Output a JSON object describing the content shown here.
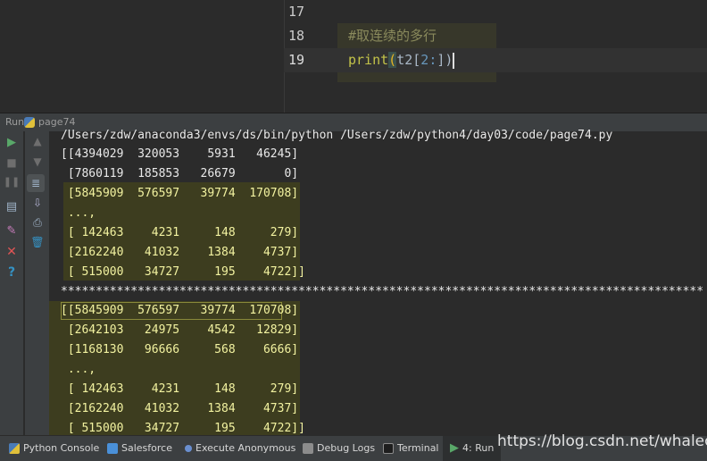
{
  "editor": {
    "lines": [
      {
        "num": "17",
        "code": ""
      },
      {
        "num": "18",
        "comment": "#取连续的多行"
      },
      {
        "num": "19",
        "fn": "print",
        "open": "(",
        "arg": "t2[",
        "idx": "2",
        "colon": ":",
        "close": "])"
      }
    ]
  },
  "run": {
    "label": "Run",
    "config_name": "page74"
  },
  "console": {
    "lines": [
      "/Users/zdw/anaconda3/envs/ds/bin/python /Users/zdw/python4/day03/code/page74.py",
      "[[4394029  320053    5931   46245]",
      " [7860119  185853   26679       0]",
      " [5845909  576597   39774  170708]",
      " ...,",
      " [ 142463    4231     148     279]",
      " [2162240   41032    1384    4737]",
      " [ 515000   34727     195    4722]]",
      "**********************************************************************************************",
      "[[5845909  576597   39774  170708]",
      " [2642103   24975    4542   12829]",
      " [1168130   96666     568    6666]",
      " ...,",
      " [ 142463    4231     148     279]",
      " [2162240   41032    1384    4737]",
      " [ 515000   34727     195    4722]]"
    ]
  },
  "statusbar": {
    "items": [
      {
        "label": "Python Console",
        "icon": "python-console-icon"
      },
      {
        "label": "Salesforce",
        "icon": "salesforce-icon"
      },
      {
        "label": "Execute Anonymous",
        "icon": "execute-anonymous-icon"
      },
      {
        "label": "Debug Logs",
        "icon": "debug-logs-icon"
      },
      {
        "label": "Terminal",
        "icon": "terminal-icon"
      },
      {
        "label": "4: Run",
        "icon": "run-icon"
      }
    ]
  },
  "watermark": "https://blog.csdn.net/whalecode"
}
